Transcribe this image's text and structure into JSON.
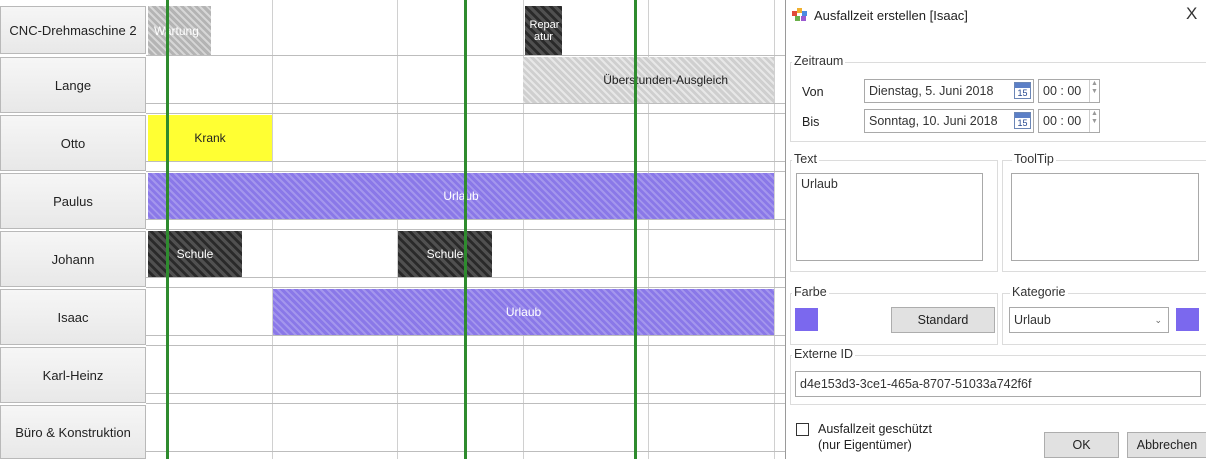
{
  "schedule": {
    "rows": [
      {
        "label": "CNC-Drehmaschine 2"
      },
      {
        "label": "Lange"
      },
      {
        "label": "Otto"
      },
      {
        "label": "Paulus"
      },
      {
        "label": "Johann"
      },
      {
        "label": "Isaac"
      },
      {
        "label": "Karl-Heinz"
      },
      {
        "label": "Büro & Konstruktion"
      }
    ],
    "events": {
      "wartung": "Wartung",
      "reparatur": "Repar atur",
      "ueberstunden": "Überstunden-Ausgleich",
      "krank": "Krank",
      "urlaub_paulus": "Urlaub",
      "schule_1": "Schule",
      "schule_2": "Schule",
      "urlaub_isaac": "Urlaub"
    },
    "colors": {
      "urlaub": "#8a78e8",
      "krank": "#ffff33",
      "schule": "#2a2a2a",
      "wartung": "#b4b4b4",
      "now_line": "#2e8b2e"
    }
  },
  "dialog": {
    "title": "Ausfallzeit erstellen [Isaac]",
    "close_glyph": "X",
    "zeitraum": {
      "label": "Zeitraum",
      "von_label": "Von",
      "von_date": "Dienstag, 5. Juni 2018",
      "von_time": "00 : 00",
      "bis_label": "Bis",
      "bis_date": "Sonntag, 10. Juni 2018",
      "bis_time": "00 : 00",
      "cal_day": "15"
    },
    "text": {
      "label": "Text",
      "value": "Urlaub"
    },
    "tooltip": {
      "label": "ToolTip",
      "value": ""
    },
    "farbe": {
      "label": "Farbe",
      "color": "#7b68ee",
      "standard_button": "Standard"
    },
    "kategorie": {
      "label": "Kategorie",
      "selected": "Urlaub",
      "color": "#7b68ee"
    },
    "externe_id": {
      "label": "Externe ID",
      "value": "d4e153d3-3ce1-465a-8707-51033a742f6f"
    },
    "protected": {
      "line1": "Ausfallzeit geschützt",
      "line2": "(nur Eigentümer)",
      "checked": false
    },
    "ok_button": "OK",
    "cancel_button": "Abbrechen"
  }
}
